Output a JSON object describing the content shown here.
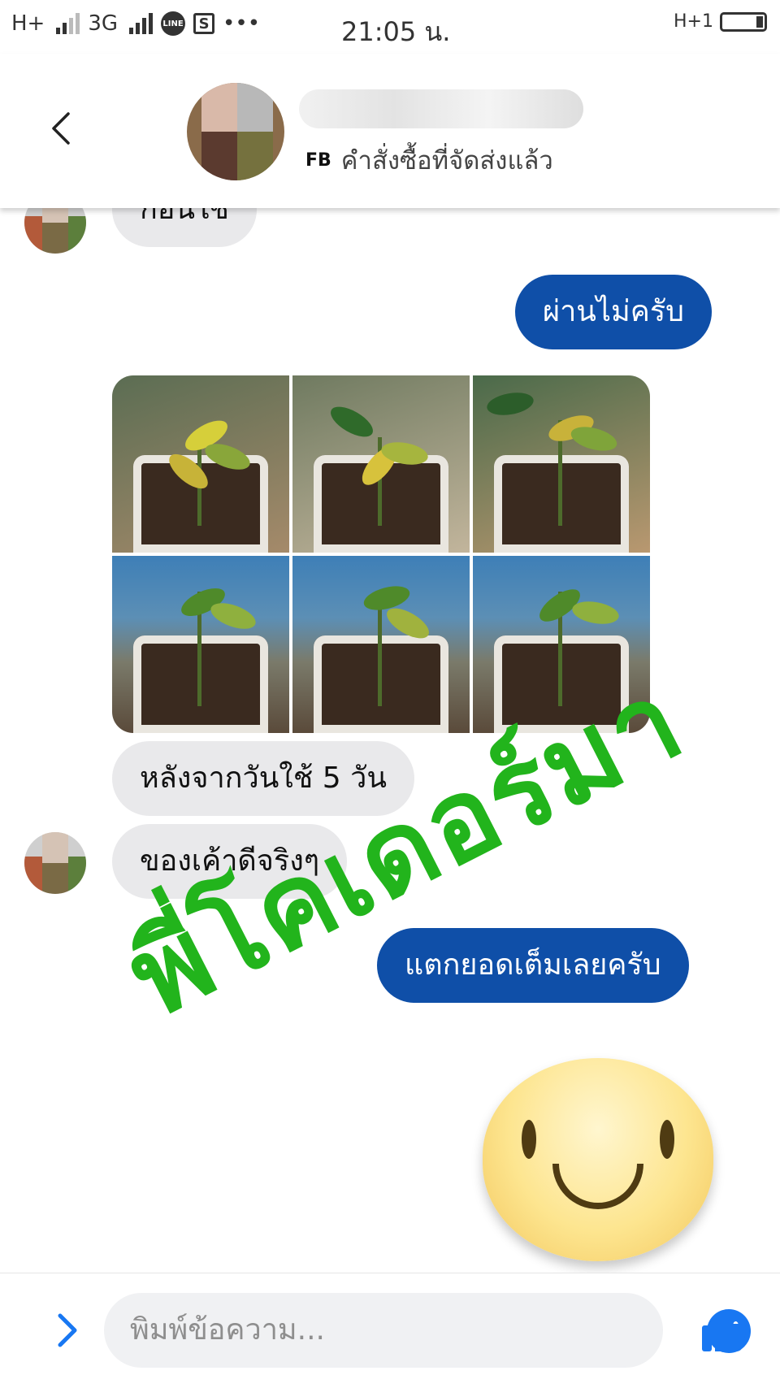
{
  "status_bar": {
    "left_network": "H+",
    "network_type": "3G",
    "line_icon": "LINE",
    "s_icon": "S",
    "more": "•••",
    "time": "21:05 น.",
    "right_network": "H+1"
  },
  "header": {
    "badge": "FB",
    "subtitle": "คำสั่งซื้อที่จัดส่งแล้ว"
  },
  "messages": {
    "partial_top": "ก่อนใช้",
    "out_1": "ผ่านไม่ครับ",
    "in_1": "หลังจากวันใช้ 5 วัน",
    "in_2": "ของเค้าดีจริงๆ",
    "out_2": "แตกยอดเต็มเลยครับ"
  },
  "watermark": "พี่โคเดอร์มา",
  "composer": {
    "placeholder": "พิมพ์ข้อความ..."
  },
  "colors": {
    "outgoing_bubble": "#0f4fa8",
    "incoming_bubble": "#e9e9eb",
    "watermark": "#22b41c",
    "messenger_blue": "#1877f2"
  }
}
